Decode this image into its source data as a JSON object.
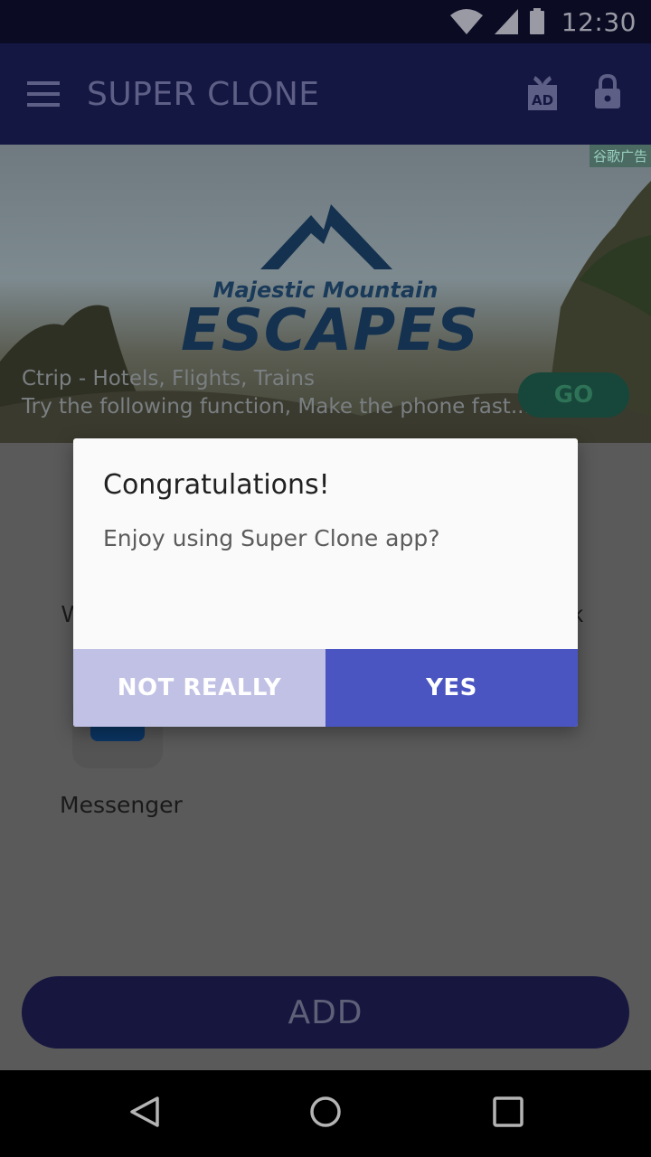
{
  "status_bar": {
    "time": "12:30",
    "icons": [
      "wifi-icon",
      "signal-icon",
      "battery-icon"
    ]
  },
  "app_bar": {
    "title": "SUPER CLONE",
    "actions": [
      "ad-gift-icon",
      "lock-icon"
    ]
  },
  "ad": {
    "tag": "谷歌广告",
    "subtitle": "Majestic Mountain",
    "headline": "ESCAPES",
    "line1": "Ctrip - Hotels, Flights, Trains",
    "line2": "Try the following function, Make the phone fast...",
    "cta": "GO"
  },
  "content": {
    "left_partial": "W",
    "right_partial": "k",
    "app_name": "Messenger",
    "add_label": "ADD"
  },
  "dialog": {
    "title": "Congratulations!",
    "message": "Enjoy using Super Clone app?",
    "negative": "NOT REALLY",
    "positive": "YES"
  },
  "colors": {
    "status_bar": "#0b0b24",
    "app_bar": "#151743",
    "primary_button": "#4a55c1",
    "secondary_button": "#c0c1e4"
  }
}
